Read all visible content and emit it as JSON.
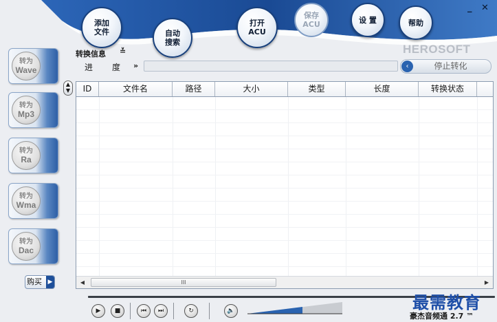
{
  "window": {
    "brand": "HEROSOFT",
    "minimize_label": "_",
    "close_label": "✕"
  },
  "toolbar": {
    "add_files": [
      "添加",
      "文件"
    ],
    "auto_search": [
      "自动",
      "搜索"
    ],
    "open_acu": [
      "打开",
      "ACU"
    ],
    "save_acu": [
      "保存",
      "ACU"
    ],
    "settings": [
      "设 置"
    ],
    "help": [
      "帮助"
    ]
  },
  "convert_buttons": [
    {
      "prefix": "转为",
      "format": "Wave"
    },
    {
      "prefix": "转为",
      "format": "Mp3"
    },
    {
      "prefix": "转为",
      "format": "Ra"
    },
    {
      "prefix": "转为",
      "format": "Wma"
    },
    {
      "prefix": "转为",
      "format": "Dac"
    }
  ],
  "buy_label": "购买",
  "info": {
    "title": "转换信息",
    "toggle": "≚",
    "progress_label": "进度",
    "progress_arrow": "»",
    "progress_value": 0,
    "stop_label": "停止转化",
    "stop_lead": "‹"
  },
  "table": {
    "columns": [
      "ID",
      "文件名",
      "路径",
      "大小",
      "类型",
      "长度",
      "转换状态"
    ],
    "rows": [],
    "scroll_thumb_label": "III",
    "scroll_left": "◀",
    "scroll_right": "▶"
  },
  "player": {
    "play": "▶",
    "stop": "■",
    "prev": "⏮",
    "next": "⏭",
    "repeat": "↻",
    "mute": "🔈"
  },
  "footer": {
    "product_title": "豪杰音频通 2.7 ™",
    "watermark": "最需教育"
  },
  "colors": {
    "header_blue": "#1c4f9b",
    "accent": "#2a63b0"
  }
}
